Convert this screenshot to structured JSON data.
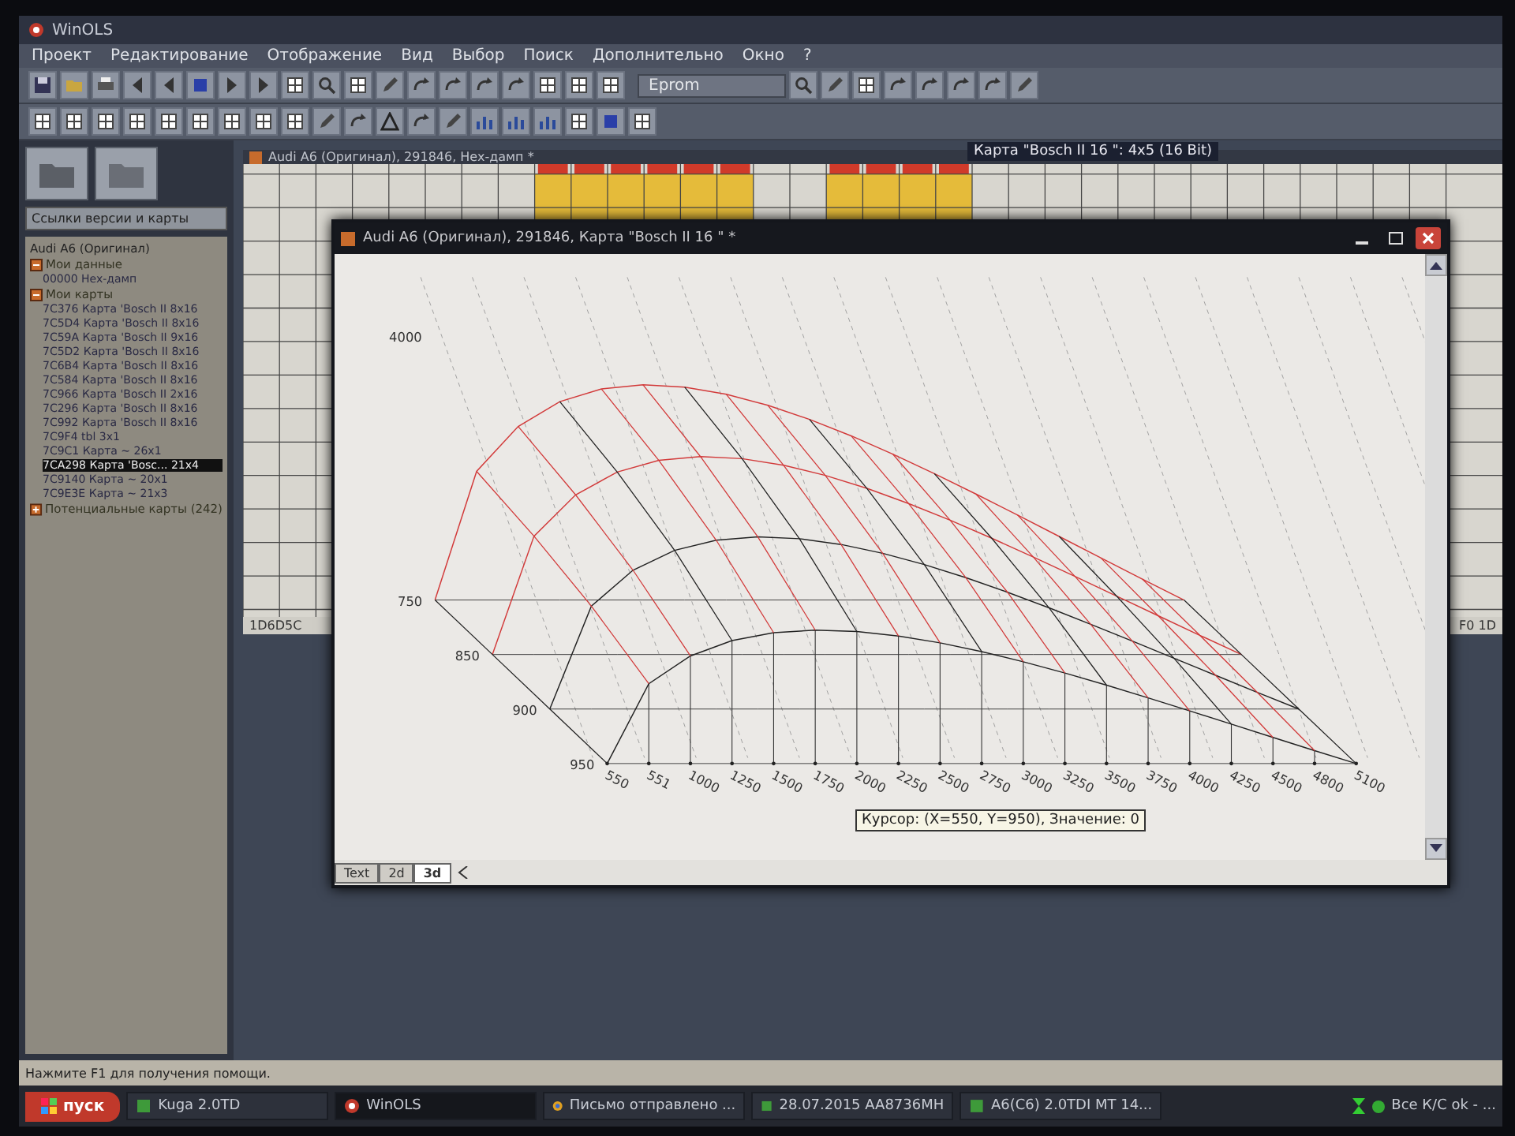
{
  "app": {
    "title": "WinOLS",
    "menu": [
      "Проект",
      "Редактирование",
      "Отображение",
      "Вид",
      "Выбор",
      "Поиск",
      "Дополнительно",
      "Окно",
      "?"
    ],
    "eprom": "Eprom"
  },
  "sidebar": {
    "dropdown": "Ссылки версии и карты",
    "project": "Audi A6 (Оригинал)",
    "groups": [
      {
        "label": "Мои данные",
        "expanded": true,
        "children": [
          {
            "address": "00000",
            "name": "Hex-дамп",
            "selected": false
          }
        ]
      },
      {
        "label": "Мои карты",
        "expanded": true,
        "children": [
          {
            "address": "7C376",
            "name": "Карта 'Bosch II",
            "size": "8x16",
            "selected": false
          },
          {
            "address": "7C5D4",
            "name": "Карта 'Bosch II",
            "size": "8x16",
            "selected": false
          },
          {
            "address": "7C59A",
            "name": "Карта 'Bosch II",
            "size": "9x16",
            "selected": false
          },
          {
            "address": "7C5D2",
            "name": "Карта 'Bosch II",
            "size": "8x16",
            "selected": false
          },
          {
            "address": "7C6B4",
            "name": "Карта 'Bosch II",
            "size": "8x16",
            "selected": false
          },
          {
            "address": "7C584",
            "name": "Карта 'Bosch II",
            "size": "8x16",
            "selected": false
          },
          {
            "address": "7C966",
            "name": "Карта 'Bosch II",
            "size": "2x16",
            "selected": false
          },
          {
            "address": "7C296",
            "name": "Карта 'Bosch II",
            "size": "8x16",
            "selected": false
          },
          {
            "address": "7C992",
            "name": "Карта 'Bosch II",
            "size": "8x16",
            "selected": false
          },
          {
            "address": "7C9F4",
            "name": "tbl",
            "size": "3x1",
            "selected": false
          },
          {
            "address": "7C9C1",
            "name": "Карта",
            "size": "~ 26x1",
            "selected": false
          },
          {
            "address": "7CA298",
            "name": "Карта 'Bosc...",
            "size": "21x4",
            "selected": true
          },
          {
            "address": "7C9140",
            "name": "Карта",
            "size": "~ 20x1",
            "selected": false
          },
          {
            "address": "7C9E3E",
            "name": "Карта",
            "size": "~ 21x3",
            "selected": false
          }
        ]
      },
      {
        "label": "Потенциальные карты (242)",
        "expanded": false
      }
    ]
  },
  "hex_window": {
    "title": "Audi A6 (Оригинал), 291846, Hex-дамп *",
    "map_tooltip": "Карта \"Bosch II 16 \": 4x5 (16 Bit)",
    "address": "1D6D5C",
    "right_value": "F0 1D"
  },
  "plot_window": {
    "title": "Audi A6 (Оригинал), 291846, Карта \"Bosch II 16 \" *",
    "z_label": "4000",
    "y_labels": [
      "750",
      "850",
      "900",
      "950"
    ],
    "x_labels": [
      "550",
      "551",
      "1000",
      "1250",
      "1500",
      "1750",
      "2000",
      "2250",
      "2500",
      "2750",
      "3000",
      "3250",
      "3500",
      "3750",
      "4000",
      "4250",
      "4500",
      "4800",
      "5100"
    ],
    "tabs": [
      {
        "label": "Text",
        "selected": false
      },
      {
        "label": "2d",
        "selected": false
      },
      {
        "label": "3d",
        "selected": true
      }
    ],
    "cursor_tooltip": "Курсор: (X=550, Y=950), Значение: 0"
  },
  "status_bar": "Нажмите F1 для получения помощи.",
  "taskbar": {
    "start": "пуск",
    "tasks": [
      {
        "label": "Kuga 2.0TD",
        "kind": "folder",
        "selected": false
      },
      {
        "label": "WinOLS",
        "kind": "app",
        "selected": true
      },
      {
        "label": "Письмо отправлено ...",
        "kind": "browser",
        "selected": false
      },
      {
        "label": "28.07.2015 AA8736MH",
        "kind": "folder",
        "selected": false
      },
      {
        "label": "A6(C6) 2.0TDI MT 14...",
        "kind": "folder",
        "selected": false
      }
    ],
    "tray": "Все К/С ok - ..."
  }
}
